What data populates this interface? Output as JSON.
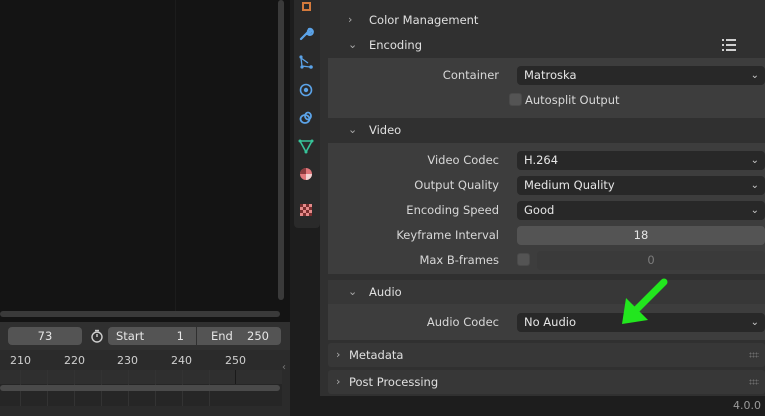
{
  "timeline": {
    "current_frame": "73",
    "start_label": "Start",
    "start_value": "1",
    "end_label": "End",
    "end_value": "250",
    "ticks": [
      "210",
      "220",
      "230",
      "240",
      "250"
    ]
  },
  "properties": {
    "color_management": {
      "title": "Color Management"
    },
    "encoding": {
      "title": "Encoding",
      "container_label": "Container",
      "container_value": "Matroska",
      "autosplit_label": "Autosplit Output"
    },
    "video": {
      "title": "Video",
      "codec_label": "Video Codec",
      "codec_value": "H.264",
      "quality_label": "Output Quality",
      "quality_value": "Medium Quality",
      "speed_label": "Encoding Speed",
      "speed_value": "Good",
      "keyframe_label": "Keyframe Interval",
      "keyframe_value": "18",
      "bframes_label": "Max B-frames",
      "bframes_value": "0"
    },
    "audio": {
      "title": "Audio",
      "codec_label": "Audio Codec",
      "codec_value": "No Audio"
    },
    "metadata": {
      "title": "Metadata"
    },
    "post_processing": {
      "title": "Post Processing"
    }
  },
  "status": {
    "version": "4.0.0"
  },
  "tab_icons": [
    "output-icon",
    "wrench-icon",
    "particles-icon",
    "physics-icon",
    "constraints-icon",
    "object-data-icon",
    "material-icon",
    "texture-icon"
  ],
  "colors": {
    "annotation_arrow": "#22e61e",
    "accent_blue": "#4a9be0"
  }
}
